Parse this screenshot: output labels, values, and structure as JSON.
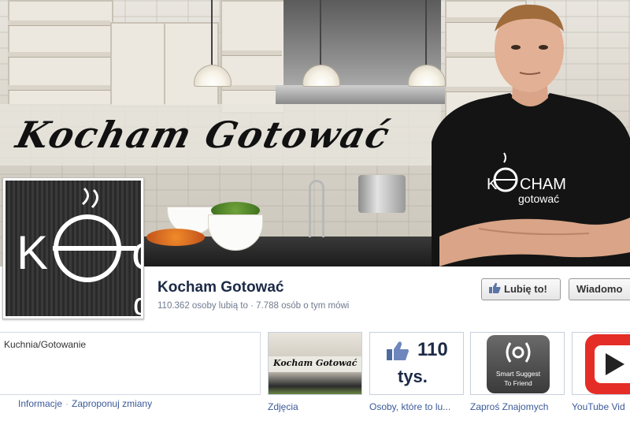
{
  "cover": {
    "script_title": "Kocham Gotować",
    "shirt_line1": "CHAM",
    "shirt_line2": "gotować"
  },
  "profile": {
    "logo_letter": "K"
  },
  "page": {
    "name": "Kocham Gotować",
    "stats": "110.362 osoby lubią to · 7.788 osób o tym mówi"
  },
  "actions": {
    "like_label": "Lubię to!",
    "message_label": "Wiadomo"
  },
  "info": {
    "category": "Kuchnia/Gotowanie",
    "link_info": "Informacje",
    "separator": "·",
    "link_suggest": "Zaproponuj zmiany"
  },
  "apps": [
    {
      "label": "Zdjęcia",
      "thumb_title": "Kocham Gotować"
    },
    {
      "label": "Osoby, które to lu...",
      "count": "110",
      "unit": "tys."
    },
    {
      "label": "Zaproś Znajomych",
      "line1": "Smart Suggest",
      "line2": "To Friend"
    },
    {
      "label": "YouTube Vid"
    }
  ],
  "colors": {
    "link": "#3b5998",
    "name": "#1c2a47",
    "youtube_red": "#e52d27"
  }
}
